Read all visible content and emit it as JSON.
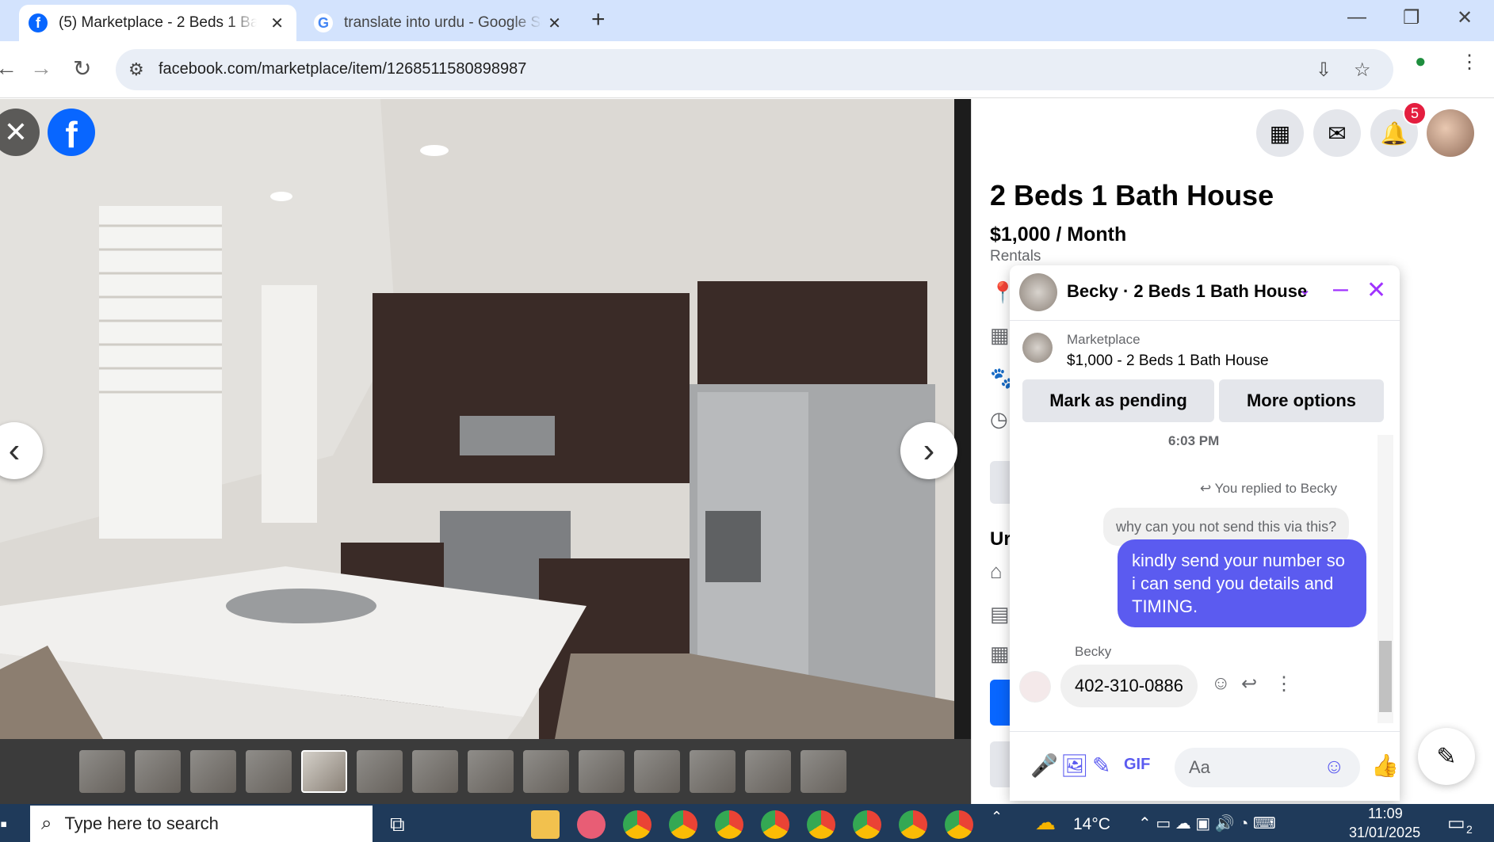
{
  "browser": {
    "tabs": [
      {
        "title": "(5) Marketplace - 2 Beds 1 Bath",
        "active": true,
        "favicon": "facebook-icon"
      },
      {
        "title": "translate into urdu - Google Sea",
        "active": false,
        "favicon": "google-icon"
      }
    ],
    "url": "facebook.com/marketplace/item/1268511580898987"
  },
  "listing": {
    "title": "2 Beds 1 Bath House",
    "price": "$1,000 / Month",
    "category": "Rentals",
    "partial_heading": "Ur"
  },
  "header": {
    "notification_count": "5"
  },
  "chat": {
    "header_name": "Becky · 2 Beds 1 Bath House",
    "context_label": "Marketplace",
    "context_item": "$1,000 - 2 Beds 1 Bath House",
    "mark_pending_label": "Mark as pending",
    "more_options_label": "More options",
    "time_separator": "6:03 PM",
    "replied_label": "You replied to Becky",
    "quoted_message": "why can you not send this via this?",
    "outgoing_message": "kindly send your number so i can send you details and TIMING.",
    "sender_name": "Becky",
    "incoming_message": "402-310-0886",
    "composer_placeholder": "Aa"
  },
  "taskbar": {
    "search_placeholder": "Type here to search",
    "temperature": "14°C",
    "time": "11:09",
    "date": "31/01/2025",
    "notification_count": "2"
  },
  "colors": {
    "facebook_blue": "#0866ff",
    "messenger_purple": "#a033ff",
    "outgoing_bubble": "#5b5bf0",
    "badge_red": "#e41e3f"
  }
}
